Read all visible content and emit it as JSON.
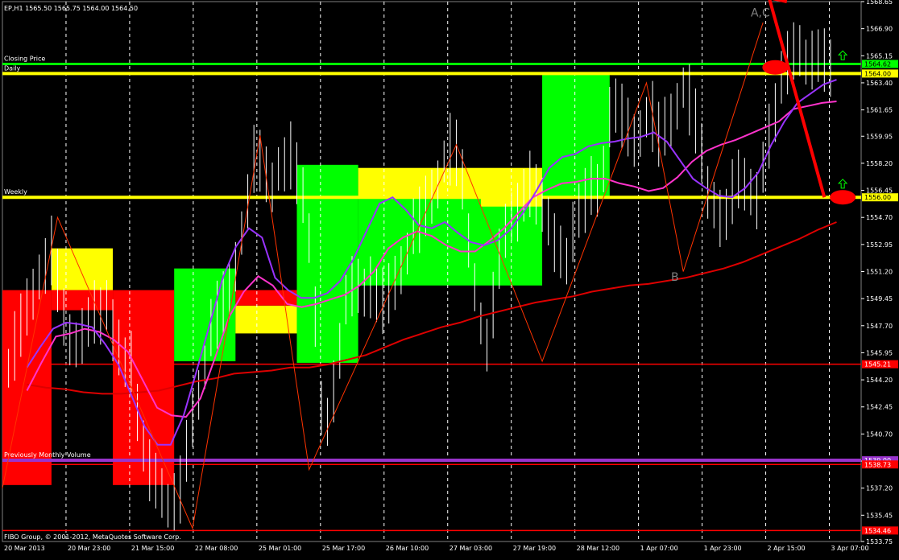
{
  "chart_data": {
    "type": "candlestick",
    "title": "EP,H1  1565.50  1565.75  1564.00  1564.50",
    "symbol": "EP,H1",
    "ohlc_header": {
      "open": 1565.5,
      "high": 1565.75,
      "low": 1564.0,
      "close": 1564.5
    },
    "copyright": "FIBO Group, © 2001-2012, MetaQuotes Software Corp.",
    "annotation_ac": "A,C",
    "annotation_b": "B",
    "ylim": [
      1533.75,
      1568.65
    ],
    "y_ticks": [
      "1568.65",
      "1566.90",
      "1565.15",
      "1563.40",
      "1561.65",
      "1559.95",
      "1558.20",
      "1556.45",
      "1554.70",
      "1552.95",
      "1551.20",
      "1549.45",
      "1547.70",
      "1545.95",
      "1544.20",
      "1542.45",
      "1540.70",
      "1538.95",
      "1537.20",
      "1535.45",
      "1533.75"
    ],
    "x_ticks": [
      "20 Mar 2013",
      "20 Mar 23:00",
      "21 Mar 15:00",
      "22 Mar 08:00",
      "25 Mar 01:00",
      "25 Mar 17:00",
      "26 Mar 10:00",
      "27 Mar 03:00",
      "27 Mar 19:00",
      "28 Mar 12:00",
      "1 Apr 07:00",
      "1 Apr 23:00",
      "2 Apr 15:00",
      "3 Apr 07:00"
    ],
    "bars": 135,
    "levels": [
      {
        "name": "Closing Price",
        "value": 1564.62,
        "label": "1564.62",
        "color": "#00ff00"
      },
      {
        "name": "Daily",
        "value": 1564.0,
        "label": "1564.00",
        "color": "#ffff00"
      },
      {
        "name": "Weekly",
        "value": 1556.0,
        "label": "1556.00",
        "color": "#ffff00"
      },
      {
        "name": "",
        "value": 1545.21,
        "label": "1545.21",
        "color": "#ff0000"
      },
      {
        "name": "Previously Monthly Volume",
        "value": 1539.0,
        "label": "1539.00",
        "color": "#9933cc"
      },
      {
        "name": "",
        "value": 1538.73,
        "label": "1538.73",
        "color": "#ff0000"
      },
      {
        "name": "",
        "value": 1534.46,
        "label": "1534.46",
        "color": "#ff0000"
      }
    ],
    "zones": [
      {
        "x": [
          0,
          8
        ],
        "y": [
          1537.4,
          1550.0
        ],
        "color": "#ff0000"
      },
      {
        "x": [
          8,
          18
        ],
        "y": [
          1550.0,
          1552.7
        ],
        "color": "#ffff00"
      },
      {
        "x": [
          8,
          18
        ],
        "y": [
          1548.7,
          1550.0
        ],
        "color": "#ff0000"
      },
      {
        "x": [
          18,
          28
        ],
        "y": [
          1537.4,
          1550.0
        ],
        "color": "#ff0000"
      },
      {
        "x": [
          28,
          38
        ],
        "y": [
          1545.4,
          1551.4
        ],
        "color": "#00ff00"
      },
      {
        "x": [
          38,
          48
        ],
        "y": [
          1547.2,
          1549.0
        ],
        "color": "#ffff00"
      },
      {
        "x": [
          38,
          48
        ],
        "y": [
          1549.0,
          1550.0
        ],
        "color": "#ff0000"
      },
      {
        "x": [
          48,
          58
        ],
        "y": [
          1545.3,
          1558.1
        ],
        "color": "#00ff00"
      },
      {
        "x": [
          58,
          88
        ],
        "y": [
          1556.0,
          1557.9
        ],
        "color": "#ffff00"
      },
      {
        "x": [
          58,
          88
        ],
        "y": [
          1550.3,
          1556.0
        ],
        "color": "#00ff00"
      },
      {
        "x": [
          78,
          88
        ],
        "y": [
          1555.4,
          1556.0
        ],
        "color": "#ffff00"
      },
      {
        "x": [
          88,
          99
        ],
        "y": [
          1556.0,
          1564.0
        ],
        "color": "#00ff00"
      }
    ],
    "close_series": [
      1545.0,
      1546.8,
      1548.6,
      1549.7,
      1551.2,
      1553.0,
      1550.4,
      1547.2,
      1546.0,
      1547.5,
      1548.7,
      1547.9,
      1548.8,
      1547.2,
      1545.8,
      1544.9,
      1540.2,
      1538.7,
      1537.8,
      1536.7,
      1535.6,
      1537.4,
      1541.0,
      1543.0,
      1545.4,
      1548.0,
      1549.1,
      1550.1,
      1552.4,
      1556.0,
      1558.8,
      1557.9,
      1556.4,
      1558.0,
      1559.0,
      1557.5,
      1555.6,
      1551.3,
      1542.8,
      1541.6,
      1544.4,
      1549.0,
      1550.9,
      1550.2,
      1549.8,
      1549.2,
      1549.7,
      1550.6,
      1551.7,
      1553.3,
      1554.6,
      1555.8,
      1556.4,
      1558.4,
      1559.3,
      1558.3,
      1553.0,
      1549.0,
      1546.4,
      1549.0,
      1553.1,
      1554.4,
      1555.5,
      1557.0,
      1556.1,
      1555.2,
      1553.7,
      1552.9,
      1552.1,
      1554.1,
      1555.8,
      1557.1,
      1556.4,
      1560.6,
      1561.6,
      1561.2,
      1559.7,
      1560.3,
      1561.9,
      1560.0,
      1560.7,
      1561.2,
      1563.2,
      1562.0,
      1560.0,
      1556.3,
      1555.2,
      1555.0,
      1556.1,
      1557.2,
      1556.2,
      1556.0,
      1558.9,
      1560.3,
      1563.4,
      1565.4,
      1566.0,
      1565.0,
      1564.3,
      1565.2,
      1564.5
    ],
    "ma_purple": [
      1545.0,
      1546.3,
      1547.5,
      1547.9,
      1547.8,
      1547.6,
      1546.5,
      1545.2,
      1543.2,
      1541.2,
      1540.0,
      1540.0,
      1541.9,
      1544.8,
      1547.8,
      1550.8,
      1552.8,
      1554.0,
      1553.4,
      1550.8,
      1550.0,
      1549.5,
      1549.5,
      1549.8,
      1550.6,
      1552.0,
      1553.8,
      1555.6,
      1556.0,
      1555.2,
      1554.2,
      1554.0,
      1554.4,
      1553.7,
      1553.1,
      1552.9,
      1553.2,
      1553.9,
      1555.0,
      1556.4,
      1557.9,
      1558.6,
      1558.8,
      1559.3,
      1559.5,
      1559.6,
      1559.8,
      1559.9,
      1560.2,
      1559.6,
      1558.4,
      1557.2,
      1556.6,
      1556.1,
      1556.0,
      1556.6,
      1557.6,
      1559.4,
      1560.9,
      1562.1,
      1562.7,
      1563.3,
      1563.6
    ],
    "ma_magenta": [
      1543.5,
      1545.3,
      1547.0,
      1547.2,
      1547.5,
      1547.3,
      1546.8,
      1546.0,
      1544.2,
      1542.4,
      1541.9,
      1541.8,
      1543.0,
      1545.6,
      1548.3,
      1549.9,
      1550.9,
      1550.3,
      1549.1,
      1548.9,
      1549.1,
      1549.4,
      1549.7,
      1550.3,
      1551.2,
      1552.7,
      1553.4,
      1553.8,
      1553.5,
      1552.9,
      1552.5,
      1552.5,
      1553.2,
      1554.0,
      1555.0,
      1556.0,
      1556.5,
      1556.9,
      1557.0,
      1557.2,
      1557.2,
      1556.9,
      1556.7,
      1556.4,
      1556.6,
      1557.3,
      1558.3,
      1559.0,
      1559.4,
      1559.7,
      1560.1,
      1560.5,
      1560.9,
      1561.7,
      1561.9,
      1562.1,
      1562.2
    ],
    "ma_red": [
      1543.9,
      1543.7,
      1543.6,
      1543.4,
      1543.3,
      1543.3,
      1543.4,
      1543.5,
      1543.8,
      1544.1,
      1544.3,
      1544.6,
      1544.7,
      1544.8,
      1545.0,
      1545.0,
      1545.2,
      1545.5,
      1545.8,
      1546.3,
      1546.8,
      1547.2,
      1547.6,
      1547.9,
      1548.3,
      1548.6,
      1548.9,
      1549.2,
      1549.4,
      1549.6,
      1549.9,
      1550.1,
      1550.3,
      1550.4,
      1550.6,
      1550.8,
      1551.1,
      1551.4,
      1551.8,
      1552.3,
      1552.8,
      1553.3,
      1553.9,
      1554.4
    ],
    "zigzag": [
      [
        0,
        1537.2
      ],
      [
        9,
        1554.7
      ],
      [
        31,
        1534.6
      ],
      [
        42,
        1560.0
      ],
      [
        50,
        1538.4
      ],
      [
        74,
        1559.4
      ],
      [
        88,
        1545.4
      ],
      [
        105,
        1563.4
      ],
      [
        111,
        1551.2
      ],
      [
        124,
        1567.3
      ]
    ],
    "trend_line": [
      [
        125,
        1568.9
      ],
      [
        134,
        1556.0
      ]
    ],
    "markers": [
      {
        "x": 126,
        "y": 1564.4,
        "shape": "ellipse",
        "color": "#ff0000"
      },
      {
        "x": 137,
        "y": 1556.0,
        "shape": "ellipse",
        "color": "#ff0000"
      }
    ],
    "arrows": [
      {
        "x": 137,
        "y": 1565.1,
        "color": "#00ff00"
      },
      {
        "x": 137,
        "y": 1556.8,
        "color": "#00ff00"
      }
    ],
    "grid": true
  }
}
